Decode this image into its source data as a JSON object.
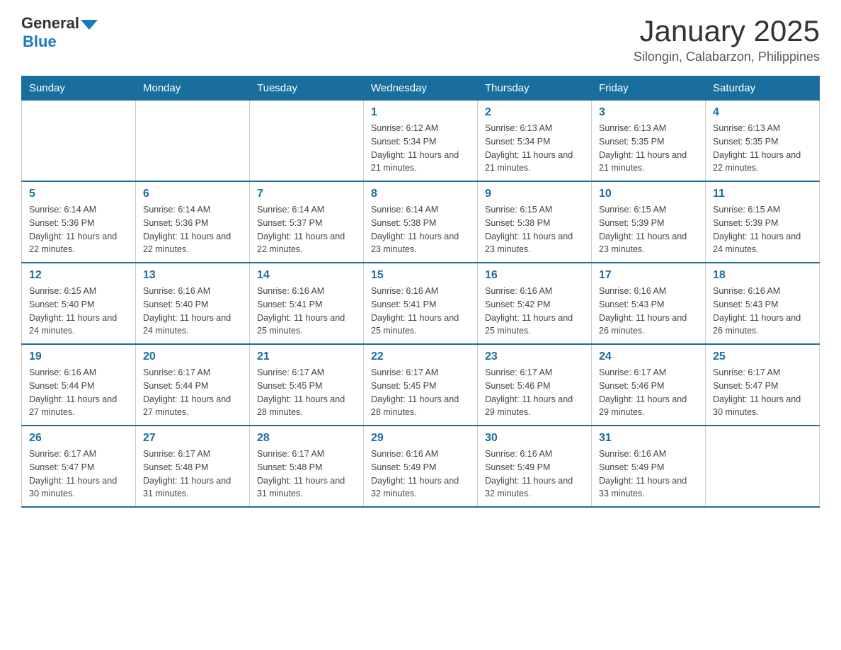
{
  "logo": {
    "general": "General",
    "blue": "Blue"
  },
  "header": {
    "month_year": "January 2025",
    "location": "Silongin, Calabarzon, Philippines"
  },
  "days_of_week": [
    "Sunday",
    "Monday",
    "Tuesday",
    "Wednesday",
    "Thursday",
    "Friday",
    "Saturday"
  ],
  "weeks": [
    [
      {
        "day": "",
        "info": ""
      },
      {
        "day": "",
        "info": ""
      },
      {
        "day": "",
        "info": ""
      },
      {
        "day": "1",
        "info": "Sunrise: 6:12 AM\nSunset: 5:34 PM\nDaylight: 11 hours and 21 minutes."
      },
      {
        "day": "2",
        "info": "Sunrise: 6:13 AM\nSunset: 5:34 PM\nDaylight: 11 hours and 21 minutes."
      },
      {
        "day": "3",
        "info": "Sunrise: 6:13 AM\nSunset: 5:35 PM\nDaylight: 11 hours and 21 minutes."
      },
      {
        "day": "4",
        "info": "Sunrise: 6:13 AM\nSunset: 5:35 PM\nDaylight: 11 hours and 22 minutes."
      }
    ],
    [
      {
        "day": "5",
        "info": "Sunrise: 6:14 AM\nSunset: 5:36 PM\nDaylight: 11 hours and 22 minutes."
      },
      {
        "day": "6",
        "info": "Sunrise: 6:14 AM\nSunset: 5:36 PM\nDaylight: 11 hours and 22 minutes."
      },
      {
        "day": "7",
        "info": "Sunrise: 6:14 AM\nSunset: 5:37 PM\nDaylight: 11 hours and 22 minutes."
      },
      {
        "day": "8",
        "info": "Sunrise: 6:14 AM\nSunset: 5:38 PM\nDaylight: 11 hours and 23 minutes."
      },
      {
        "day": "9",
        "info": "Sunrise: 6:15 AM\nSunset: 5:38 PM\nDaylight: 11 hours and 23 minutes."
      },
      {
        "day": "10",
        "info": "Sunrise: 6:15 AM\nSunset: 5:39 PM\nDaylight: 11 hours and 23 minutes."
      },
      {
        "day": "11",
        "info": "Sunrise: 6:15 AM\nSunset: 5:39 PM\nDaylight: 11 hours and 24 minutes."
      }
    ],
    [
      {
        "day": "12",
        "info": "Sunrise: 6:15 AM\nSunset: 5:40 PM\nDaylight: 11 hours and 24 minutes."
      },
      {
        "day": "13",
        "info": "Sunrise: 6:16 AM\nSunset: 5:40 PM\nDaylight: 11 hours and 24 minutes."
      },
      {
        "day": "14",
        "info": "Sunrise: 6:16 AM\nSunset: 5:41 PM\nDaylight: 11 hours and 25 minutes."
      },
      {
        "day": "15",
        "info": "Sunrise: 6:16 AM\nSunset: 5:41 PM\nDaylight: 11 hours and 25 minutes."
      },
      {
        "day": "16",
        "info": "Sunrise: 6:16 AM\nSunset: 5:42 PM\nDaylight: 11 hours and 25 minutes."
      },
      {
        "day": "17",
        "info": "Sunrise: 6:16 AM\nSunset: 5:43 PM\nDaylight: 11 hours and 26 minutes."
      },
      {
        "day": "18",
        "info": "Sunrise: 6:16 AM\nSunset: 5:43 PM\nDaylight: 11 hours and 26 minutes."
      }
    ],
    [
      {
        "day": "19",
        "info": "Sunrise: 6:16 AM\nSunset: 5:44 PM\nDaylight: 11 hours and 27 minutes."
      },
      {
        "day": "20",
        "info": "Sunrise: 6:17 AM\nSunset: 5:44 PM\nDaylight: 11 hours and 27 minutes."
      },
      {
        "day": "21",
        "info": "Sunrise: 6:17 AM\nSunset: 5:45 PM\nDaylight: 11 hours and 28 minutes."
      },
      {
        "day": "22",
        "info": "Sunrise: 6:17 AM\nSunset: 5:45 PM\nDaylight: 11 hours and 28 minutes."
      },
      {
        "day": "23",
        "info": "Sunrise: 6:17 AM\nSunset: 5:46 PM\nDaylight: 11 hours and 29 minutes."
      },
      {
        "day": "24",
        "info": "Sunrise: 6:17 AM\nSunset: 5:46 PM\nDaylight: 11 hours and 29 minutes."
      },
      {
        "day": "25",
        "info": "Sunrise: 6:17 AM\nSunset: 5:47 PM\nDaylight: 11 hours and 30 minutes."
      }
    ],
    [
      {
        "day": "26",
        "info": "Sunrise: 6:17 AM\nSunset: 5:47 PM\nDaylight: 11 hours and 30 minutes."
      },
      {
        "day": "27",
        "info": "Sunrise: 6:17 AM\nSunset: 5:48 PM\nDaylight: 11 hours and 31 minutes."
      },
      {
        "day": "28",
        "info": "Sunrise: 6:17 AM\nSunset: 5:48 PM\nDaylight: 11 hours and 31 minutes."
      },
      {
        "day": "29",
        "info": "Sunrise: 6:16 AM\nSunset: 5:49 PM\nDaylight: 11 hours and 32 minutes."
      },
      {
        "day": "30",
        "info": "Sunrise: 6:16 AM\nSunset: 5:49 PM\nDaylight: 11 hours and 32 minutes."
      },
      {
        "day": "31",
        "info": "Sunrise: 6:16 AM\nSunset: 5:49 PM\nDaylight: 11 hours and 33 minutes."
      },
      {
        "day": "",
        "info": ""
      }
    ]
  ]
}
